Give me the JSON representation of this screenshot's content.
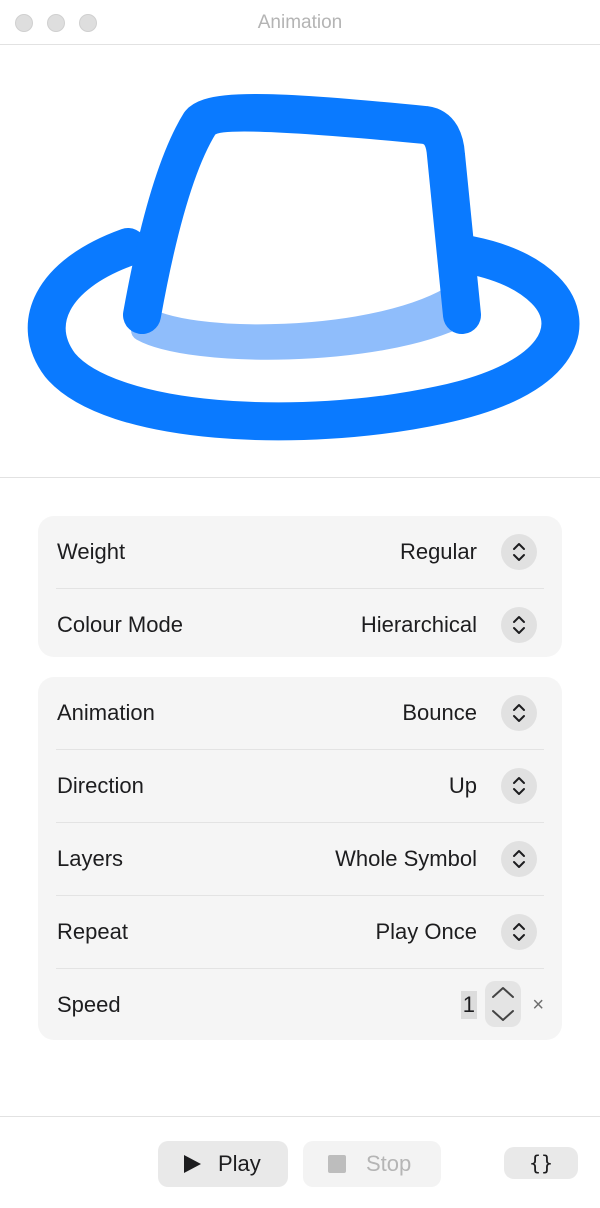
{
  "window": {
    "title": "Animation"
  },
  "preview": {
    "symbol": "hat-icon",
    "primary_color": "#0a7aff",
    "secondary_color": "#8fbdfb"
  },
  "options": {
    "weight": {
      "label": "Weight",
      "value": "Regular"
    },
    "colour_mode": {
      "label": "Colour Mode",
      "value": "Hierarchical"
    },
    "animation": {
      "label": "Animation",
      "value": "Bounce"
    },
    "direction": {
      "label": "Direction",
      "value": "Up"
    },
    "layers": {
      "label": "Layers",
      "value": "Whole Symbol"
    },
    "repeat": {
      "label": "Repeat",
      "value": "Play Once"
    },
    "speed": {
      "label": "Speed",
      "value": "1",
      "unit": "×"
    }
  },
  "toolbar": {
    "play_label": "Play",
    "stop_label": "Stop",
    "code_label": "{}"
  }
}
